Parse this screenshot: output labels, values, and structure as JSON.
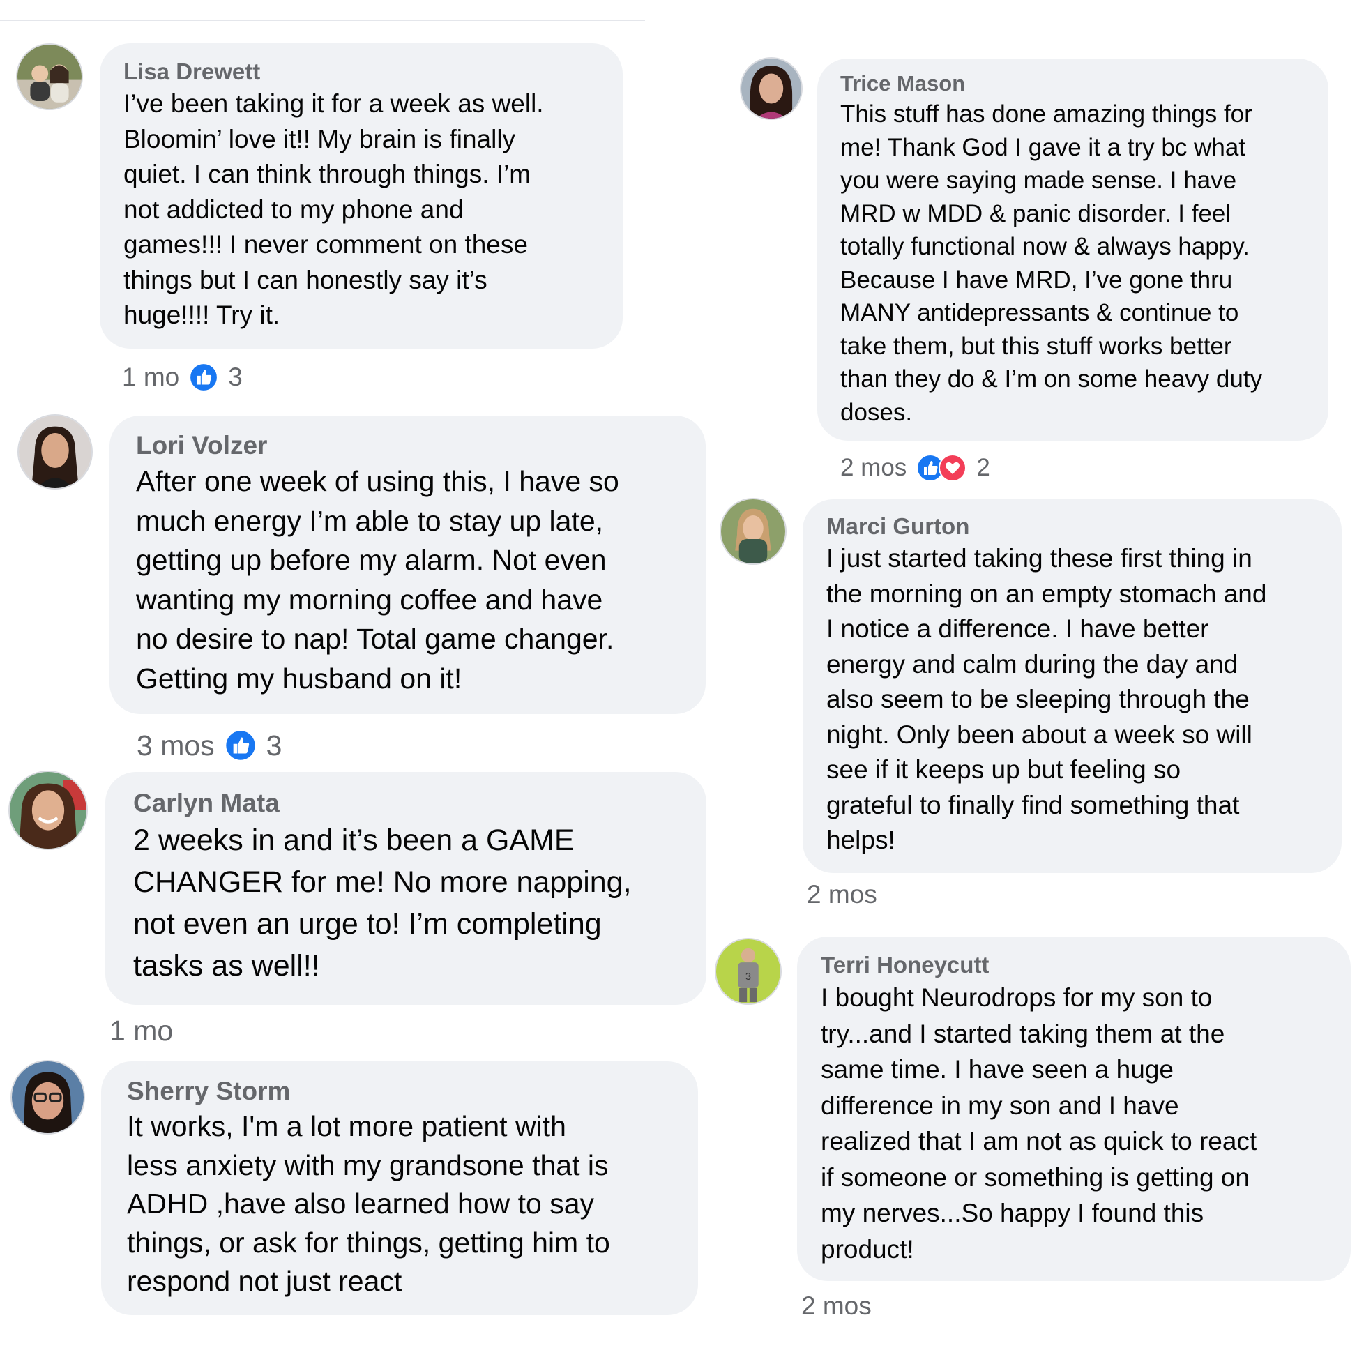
{
  "comments": [
    {
      "author": "Lisa Drewett",
      "text": "I’ve been taking it for a week as well.\nBloomin’ love it!! My brain is finally\nquiet. I can think through things. I’m\nnot addicted to my phone and\ngames!!! I never comment on these\nthings but I can honestly say it’s\nhuge!!!! Try it.",
      "time": "1 mo",
      "reactions": [
        "like"
      ],
      "reaction_count": "3"
    },
    {
      "author": "Lori Volzer",
      "text": "After one week of using this, I have so\nmuch energy I’m able to stay up late,\ngetting up before my alarm. Not even\nwanting my morning coffee and have\nno desire to nap! Total game changer.\nGetting my husband on it!",
      "time": "3 mos",
      "reactions": [
        "like"
      ],
      "reaction_count": "3"
    },
    {
      "author": "Carlyn Mata",
      "text": "2 weeks in and it’s been a GAME\nCHANGER for me! No more napping,\nnot even an urge to! I’m completing\ntasks as well!!",
      "time": "1 mo",
      "reactions": [],
      "reaction_count": ""
    },
    {
      "author": "Sherry Storm",
      "text": "It works, I'm a lot more patient with\nless anxiety with my grandsone that is\nADHD ,have also learned how to say\nthings, or ask for things, getting him to\nrespond not just react",
      "time": "",
      "reactions": [],
      "reaction_count": ""
    },
    {
      "author": "Trice Mason",
      "text": "This stuff has done amazing things for\nme! Thank God I gave it a try bc what\nyou were saying made sense. I have\nMRD w MDD & panic disorder. I feel\ntotally functional now & always happy.\nBecause I have MRD, I’ve gone thru\nMANY antidepressants & continue to\ntake them, but this stuff works better\nthan they do & I’m on some heavy duty\ndoses.",
      "time": "2 mos",
      "reactions": [
        "like",
        "love"
      ],
      "reaction_count": "2"
    },
    {
      "author": "Marci Gurton",
      "text": "I just started taking these first thing in\nthe morning on an empty stomach and\nI notice a difference. I have better\nenergy and calm during the day and\nalso seem to be sleeping through the\nnight. Only been about a week so will\nsee if it keeps up but feeling so\ngrateful to finally find something that\nhelps!",
      "time": "2 mos",
      "reactions": [],
      "reaction_count": ""
    },
    {
      "author": "Terri Honeycutt",
      "text": "I bought Neurodrops for my son to\ntry...and I started taking them at the\nsame time. I have seen a huge\ndifference in my son and I have\nrealized that I am not as quick to react\nif someone or something is getting on\nmy nerves...So happy I found this\nproduct!",
      "time": "2 mos",
      "reactions": [],
      "reaction_count": ""
    }
  ],
  "colors": {
    "bubble": "#f0f2f5",
    "author": "#65676b",
    "text": "#050505",
    "like": "#1877f2",
    "love": "#f33e58"
  }
}
